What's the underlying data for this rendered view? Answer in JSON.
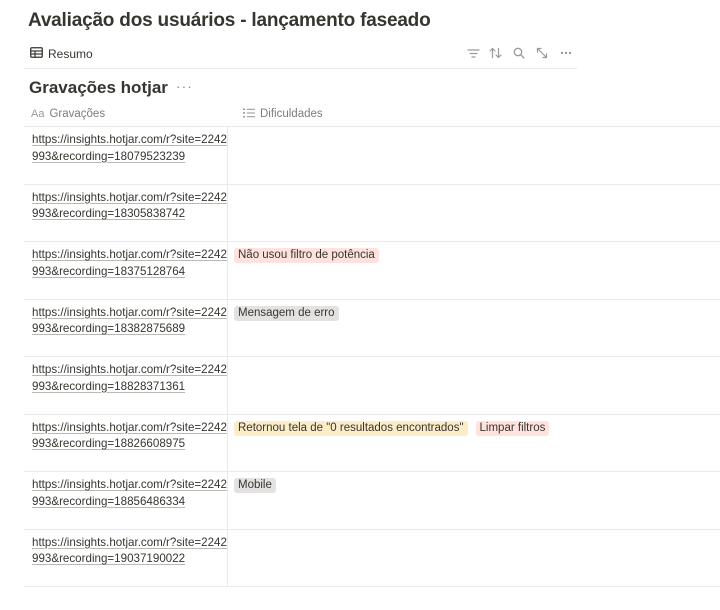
{
  "page": {
    "title": "Avaliação dos usuários - lançamento faseado"
  },
  "viewbar": {
    "tab_label": "Resumo",
    "tools": [
      "filter-icon",
      "sort-icon",
      "search-icon",
      "expand-icon",
      "more-icon"
    ]
  },
  "database": {
    "title": "Gravações hotjar",
    "more": "···",
    "columns": [
      {
        "label": "Gravações",
        "prefix": "Aa"
      },
      {
        "label": "Dificuldades",
        "icon": "list-icon"
      }
    ],
    "rows": [
      {
        "url": "https://insights.hotjar.com/r?site=2242993&recording=18079523239",
        "tags": []
      },
      {
        "url": "https://insights.hotjar.com/r?site=2242993&recording=18305838742",
        "tags": []
      },
      {
        "url": "https://insights.hotjar.com/r?site=2242993&recording=18375128764",
        "tags": [
          {
            "text": "Não usou filtro de potência",
            "color": "#ffe2dd"
          }
        ]
      },
      {
        "url": "https://insights.hotjar.com/r?site=2242993&recording=18382875689",
        "tags": [
          {
            "text": "Mensagem de erro",
            "color": "#e3e2e0"
          }
        ]
      },
      {
        "url": "https://insights.hotjar.com/r?site=2242993&recording=18828371361",
        "tags": []
      },
      {
        "url": "https://insights.hotjar.com/r?site=2242993&recording=18826608975",
        "tags": [
          {
            "text": "Retornou tela de \"0 resultados encontrados\"",
            "color": "#fdecc8"
          },
          {
            "text": "Limpar filtros",
            "color": "#ffe2dd"
          }
        ]
      },
      {
        "url": "https://insights.hotjar.com/r?site=2242993&recording=18856486334",
        "tags": [
          {
            "text": "Mobile",
            "color": "#e3e2e0"
          }
        ]
      },
      {
        "url": "https://insights.hotjar.com/r?site=2242993&recording=19037190022",
        "tags": []
      }
    ]
  }
}
